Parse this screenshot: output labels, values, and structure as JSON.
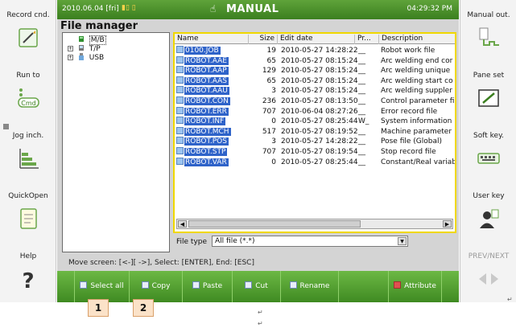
{
  "status": {
    "date": "2010.06.04 [fri]",
    "mode": "MANUAL",
    "time": "04:29:32 PM"
  },
  "window_title": "File manager",
  "left_keys": [
    {
      "label": "Record cnd.",
      "icon": "pencil-notepad-icon"
    },
    {
      "label": "Run to",
      "icon": "cmd-icon"
    },
    {
      "label": "Jog inch.",
      "icon": "bar-chart-icon"
    },
    {
      "label": "QuickOpen",
      "icon": "document-icon"
    },
    {
      "label": "Help",
      "icon": "question-mark-icon"
    }
  ],
  "right_keys": [
    {
      "label": "Manual out.",
      "icon": "signal-output-icon"
    },
    {
      "label": "Pane set",
      "icon": "pane-icon"
    },
    {
      "label": "Soft key.",
      "icon": "keyboard-icon"
    },
    {
      "label": "User key",
      "icon": "user-icon"
    },
    {
      "label": "PREV/NEXT",
      "icon": "prev-next-arrows-icon"
    }
  ],
  "tree": [
    {
      "label": "M/B",
      "expander": "",
      "selected": true
    },
    {
      "label": "T/P",
      "expander": "+"
    },
    {
      "label": "USB",
      "expander": "+"
    }
  ],
  "columns": [
    "Name",
    "Size",
    "Edit date",
    "Pr...",
    "Description"
  ],
  "files": [
    {
      "name": "0100.JOB",
      "size": "19",
      "date": "2010-05-27 14:28:22",
      "pr": "__",
      "desc": "Robot work file"
    },
    {
      "name": "ROBOT.AAE",
      "size": "65",
      "date": "2010-05-27 08:15:24",
      "pr": "__",
      "desc": "Arc welding end cor"
    },
    {
      "name": "ROBOT.AAP",
      "size": "129",
      "date": "2010-05-27 08:15:24",
      "pr": "__",
      "desc": "Arc welding unique"
    },
    {
      "name": "ROBOT.AAS",
      "size": "65",
      "date": "2010-05-27 08:15:24",
      "pr": "__",
      "desc": "Arc welding start co"
    },
    {
      "name": "ROBOT.AAU",
      "size": "3",
      "date": "2010-05-27 08:15:24",
      "pr": "__",
      "desc": "Arc welding suppler"
    },
    {
      "name": "ROBOT.CON",
      "size": "236",
      "date": "2010-05-27 08:13:50",
      "pr": "__",
      "desc": "Control parameter fil"
    },
    {
      "name": "ROBOT.ERR",
      "size": "707",
      "date": "2010-06-04 08:27:26",
      "pr": "__",
      "desc": "Error record file"
    },
    {
      "name": "ROBOT.INF",
      "size": "0",
      "date": "2010-05-27 08:25:44",
      "pr": "W_",
      "desc": "System information"
    },
    {
      "name": "ROBOT.MCH",
      "size": "517",
      "date": "2010-05-27 08:19:52",
      "pr": "__",
      "desc": "Machine parameter"
    },
    {
      "name": "ROBOT.POS",
      "size": "3",
      "date": "2010-05-27 14:28:22",
      "pr": "__",
      "desc": "Pose file (Global)"
    },
    {
      "name": "ROBOT.STP",
      "size": "707",
      "date": "2010-05-27 08:19:54",
      "pr": "__",
      "desc": "Stop record file"
    },
    {
      "name": "ROBOT.VAR",
      "size": "0",
      "date": "2010-05-27 08:25:44",
      "pr": "__",
      "desc": "Constant/Real variab"
    }
  ],
  "file_type": {
    "label": "File type",
    "value": "All file (*.*)"
  },
  "hint": "Move screen: [<-][ ->], Select: [ENTER], End: [ESC]",
  "function_keys": [
    "Select all",
    "Copy",
    "Paste",
    "Cut",
    "Rename",
    "",
    "Attribute"
  ],
  "callouts": [
    "1",
    "2"
  ],
  "colors": {
    "status_green": "#3b7f1f",
    "selection_blue": "#2f63c9",
    "focus_yellow": "#f0d800"
  }
}
